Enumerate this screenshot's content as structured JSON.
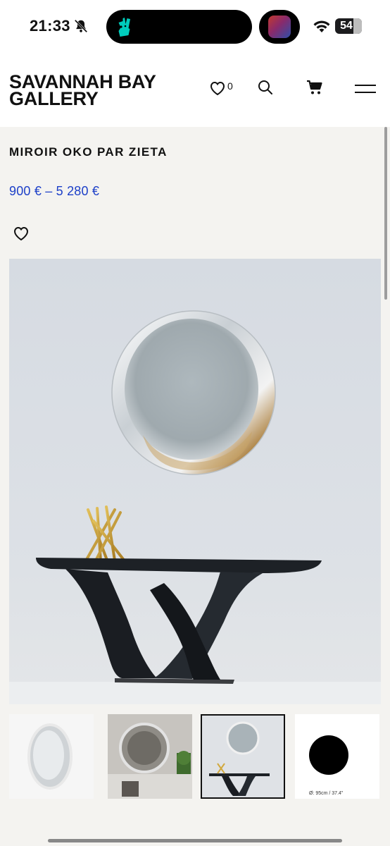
{
  "status_bar": {
    "time": "21:33",
    "battery": "54",
    "battery_level": 0.54
  },
  "header": {
    "logo_line1": "SAVANNAH BAY",
    "logo_line2": "GALLERY",
    "wishlist_count": "0"
  },
  "product": {
    "title": "MIROIR OKO PAR ZIETA",
    "price_range": "900 €  –  5 280 €"
  },
  "thumbnails": [
    {
      "name": "thumb-mirror-front"
    },
    {
      "name": "thumb-mirror-interior"
    },
    {
      "name": "thumb-mirror-console"
    },
    {
      "name": "thumb-mirror-dimensions",
      "caption": "Ø: 95cm / 37.4\""
    }
  ],
  "colors": {
    "price": "#1c3fc8",
    "background": "#f4f3f0",
    "accent_deliveroo": "#00ccbc"
  }
}
